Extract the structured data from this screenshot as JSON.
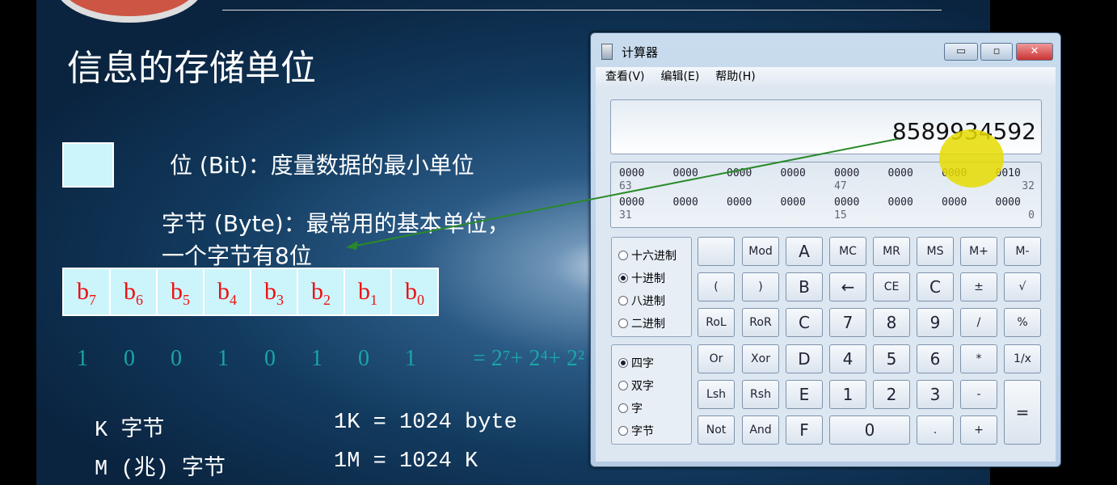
{
  "slide": {
    "title": "信息的存储单位",
    "bit_line": "位 (Bit)：度量数据的最小单位",
    "byte_line1": "字节 (Byte)：最常用的基本单位，",
    "byte_line2": "一个字节有8位",
    "bits": [
      {
        "b": "b",
        "s": "7"
      },
      {
        "b": "b",
        "s": "6"
      },
      {
        "b": "b",
        "s": "5"
      },
      {
        "b": "b",
        "s": "4"
      },
      {
        "b": "b",
        "s": "3"
      },
      {
        "b": "b",
        "s": "2"
      },
      {
        "b": "b",
        "s": "1"
      },
      {
        "b": "b",
        "s": "0"
      }
    ],
    "binary": [
      "1",
      "0",
      "0",
      "1",
      "0",
      "1",
      "0",
      "1"
    ],
    "equation": "= 2⁷+ 2⁴+ 2²",
    "k_label": "K 字节",
    "k_value": "1K = 1024 byte",
    "m_label": "M (兆) 字节",
    "m_value": "1M = 1024 K",
    "arrow_color": "#2a8a2a"
  },
  "calculator": {
    "title": "计算器",
    "minimize": "▭",
    "maximize": "▫",
    "close": "✕",
    "menu": [
      "查看(V)",
      "编辑(E)",
      "帮助(H)"
    ],
    "display": "8589934592",
    "bit_rows": [
      [
        "0000",
        "0000",
        "0000",
        "0000",
        "0000",
        "0000",
        "0000",
        "0010"
      ],
      [
        "0000",
        "0000",
        "0000",
        "0000",
        "0000",
        "0000",
        "0000",
        "0000"
      ]
    ],
    "bit_index": [
      [
        "63",
        "47",
        "32"
      ],
      [
        "31",
        "15",
        "0"
      ]
    ],
    "base_options": [
      {
        "label": "十六进制",
        "selected": false
      },
      {
        "label": "十进制",
        "selected": true
      },
      {
        "label": "八进制",
        "selected": false
      },
      {
        "label": "二进制",
        "selected": false
      }
    ],
    "word_options": [
      {
        "label": "四字",
        "selected": true
      },
      {
        "label": "双字",
        "selected": false
      },
      {
        "label": "字",
        "selected": false
      },
      {
        "label": "字节",
        "selected": false
      }
    ],
    "buttons": [
      [
        "",
        "Mod",
        "A",
        "MC",
        "MR",
        "MS",
        "M+",
        "M-"
      ],
      [
        "(",
        ")",
        "B",
        "←",
        "CE",
        "C",
        "±",
        "√"
      ],
      [
        "RoL",
        "RoR",
        "C",
        "7",
        "8",
        "9",
        "/",
        "%"
      ],
      [
        "Or",
        "Xor",
        "D",
        "4",
        "5",
        "6",
        "*",
        "1/x"
      ],
      [
        "Lsh",
        "Rsh",
        "E",
        "1",
        "2",
        "3",
        "-",
        "="
      ],
      [
        "Not",
        "And",
        "F",
        "0",
        ".",
        "+"
      ]
    ]
  }
}
